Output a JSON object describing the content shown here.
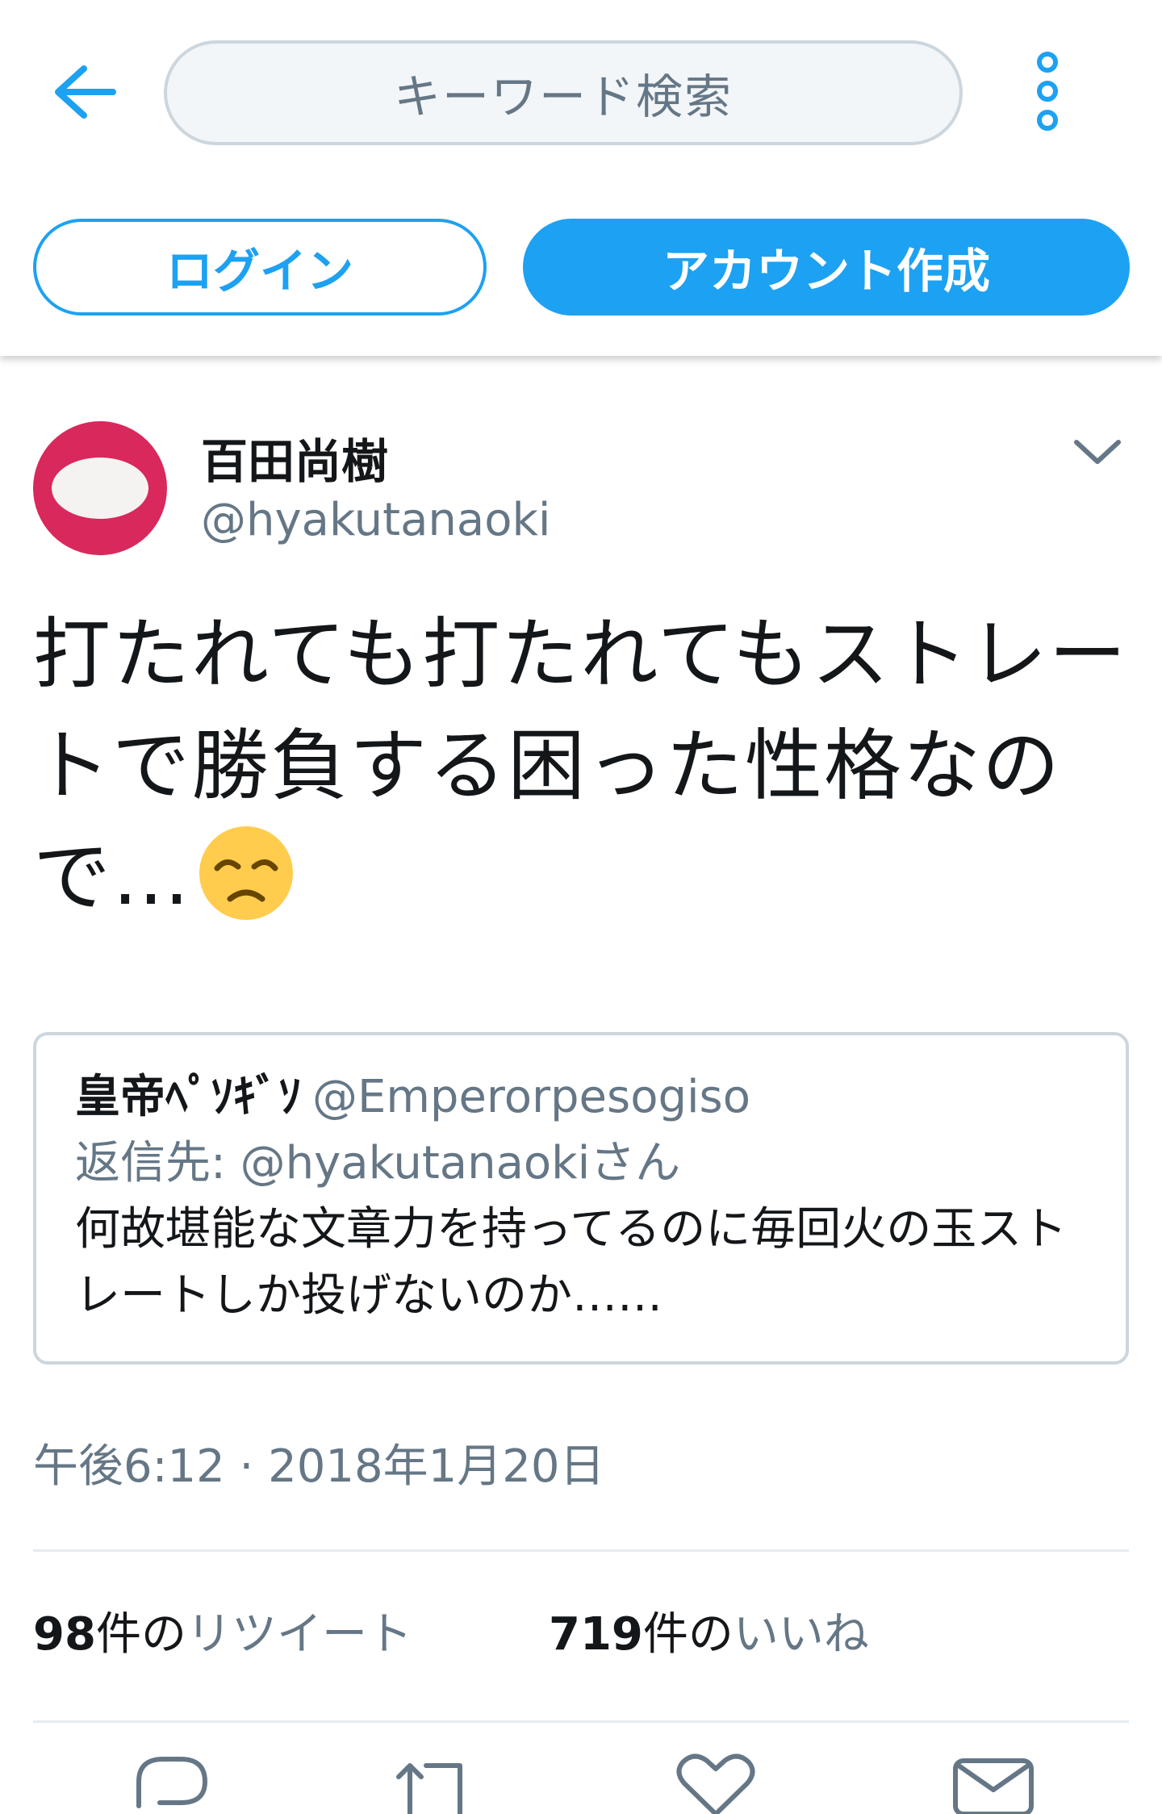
{
  "header": {
    "search_placeholder": "キーワード検索",
    "login_label": "ログイン",
    "signup_label": "アカウント作成"
  },
  "tweet": {
    "display_name": "百田尚樹",
    "handle": "@hyakutanaoki",
    "text": "打たれても打たれてもストレートで勝負する困った性格なので…",
    "emoji": "disappointed-face-emoji",
    "timestamp": "午後6:12 · 2018年1月20日"
  },
  "quoted": {
    "display_name": "皇帝ﾍﾟｿｷﾞｿ",
    "handle": "@Emperorpesogiso",
    "reply_to": "返信先: @hyakutanaokiさん",
    "text": "何故堪能な文章力を持ってるのに毎回火の玉ストレートしか投げないのか……"
  },
  "stats": {
    "retweets_count": "98",
    "retweets_mid": "件の",
    "retweets_label": "リツイート",
    "likes_count": "719",
    "likes_mid": "件の",
    "likes_label": "いいね"
  },
  "colors": {
    "accent": "#1da1f2",
    "muted": "#657786",
    "border": "#ccd6dd",
    "avatar_bg": "#d9285b"
  },
  "icons": [
    "back-arrow-icon",
    "more-vertical-icon",
    "chevron-down-icon",
    "reply-icon",
    "retweet-icon",
    "like-icon",
    "message-icon"
  ]
}
